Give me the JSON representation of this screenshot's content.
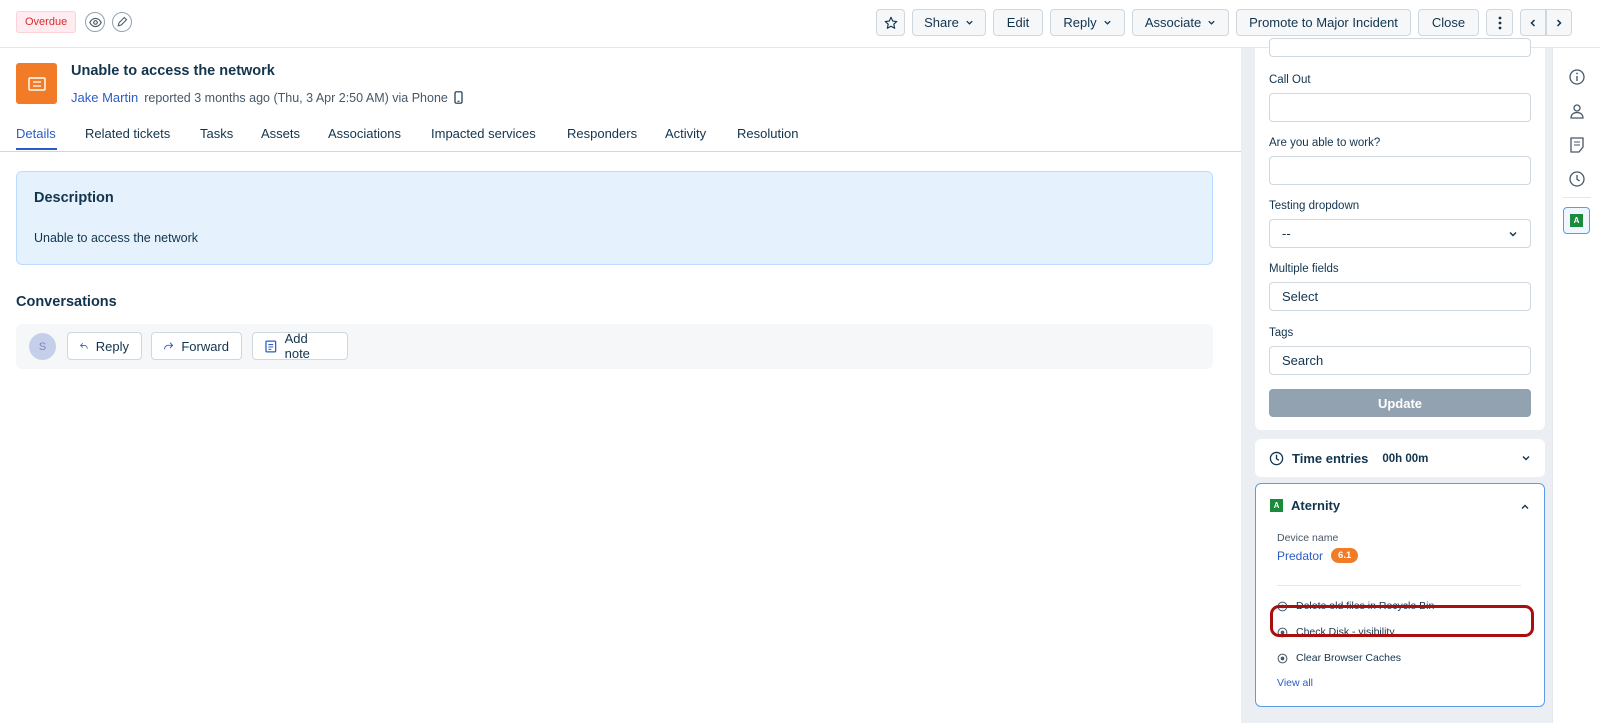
{
  "topbar": {
    "status_badge": "Overdue",
    "buttons": {
      "share": "Share",
      "edit": "Edit",
      "reply": "Reply",
      "associate": "Associate",
      "promote": "Promote to Major Incident",
      "close": "Close"
    }
  },
  "ticket": {
    "title": "Unable to access the network",
    "requester": "Jake Martin",
    "reported_text": "reported 3 months ago (Thu, 3 Apr 2:50 AM) via Phone"
  },
  "tabs": [
    "Details",
    "Related tickets",
    "Tasks",
    "Assets",
    "Associations",
    "Impacted services",
    "Responders",
    "Activity",
    "Resolution"
  ],
  "active_tab": "Details",
  "description": {
    "title": "Description",
    "text": "Unable to access the network"
  },
  "conversations": {
    "title": "Conversations",
    "avatar_initial": "S",
    "reply": "Reply",
    "forward": "Forward",
    "add_note": "Add note"
  },
  "properties": {
    "fields": [
      {
        "label": "Call Out",
        "value": ""
      },
      {
        "label": "Are you able to work?",
        "value": ""
      },
      {
        "label": "Testing dropdown",
        "value": "--"
      },
      {
        "label": "Multiple fields",
        "value": "Select"
      },
      {
        "label": "Tags",
        "value": "Search"
      }
    ],
    "update_button": "Update"
  },
  "time_entries": {
    "label": "Time entries",
    "value": "00h 00m"
  },
  "aternity": {
    "app_logo_letter": "A",
    "title": "Aternity",
    "device_label": "Device name",
    "device_name": "Predator",
    "device_score": "6.1",
    "actions": [
      "Delete old files in Recycle Bin",
      "Check Disk - visibility",
      "Clear Browser Caches"
    ],
    "view_all": "View all"
  },
  "rail": {
    "app_logo_letter": "A"
  },
  "colors": {
    "brand_blue": "#2c5cc5",
    "ticket_orange": "#f17b26",
    "score_orange": "#f17b26",
    "highlight_red": "#a80f0f",
    "update_gray": "#92a2b1"
  }
}
